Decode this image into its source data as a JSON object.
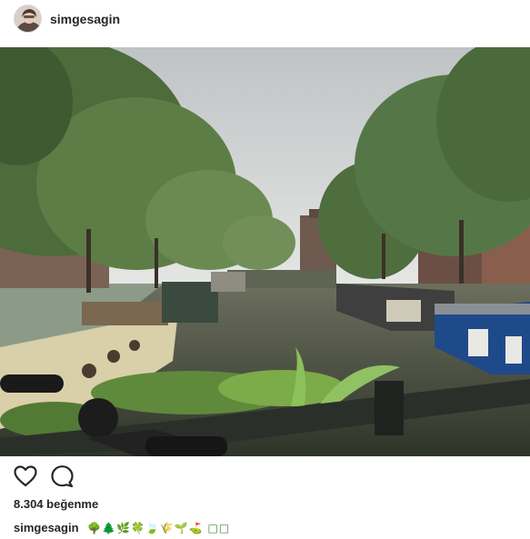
{
  "post": {
    "username": "simgesagin",
    "likes_text": "8.304 beğenme",
    "caption": {
      "username": "simgesagin",
      "text": "🌳🌲🌿🍀🍃🌾🌱⛳ □□"
    },
    "image_subject": "Amsterdam canal with houseboats and trees",
    "actions": {
      "like_icon": "heart-outline-icon",
      "comment_icon": "speech-bubble-icon"
    }
  }
}
